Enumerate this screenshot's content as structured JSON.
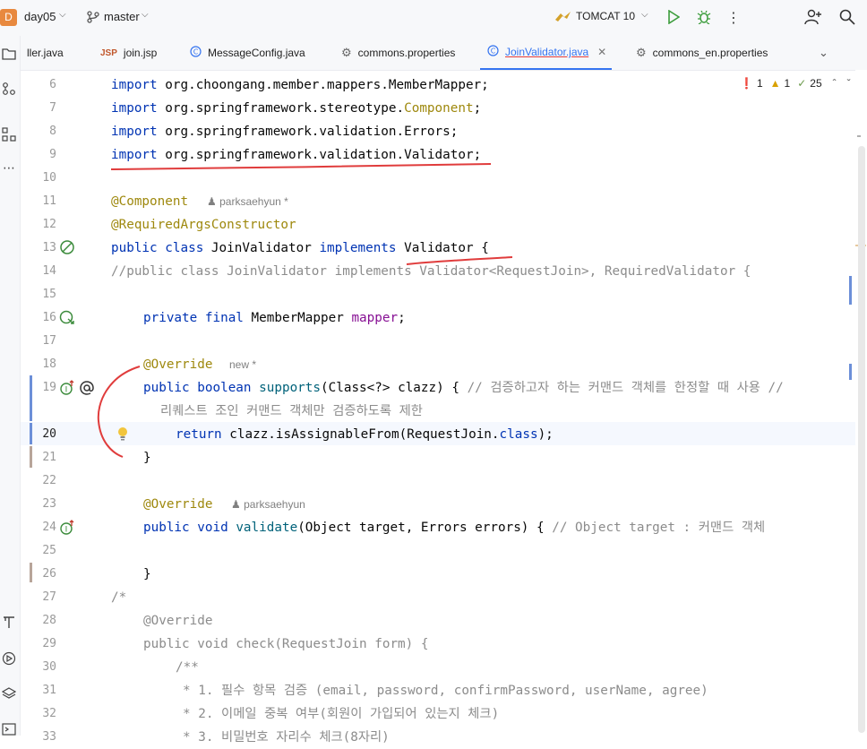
{
  "topbar": {
    "project_initial": "D",
    "project_name": "day05",
    "branch": "master",
    "run_config": "TOMCAT 10"
  },
  "tabs": [
    {
      "label": "ller.java",
      "type": "java"
    },
    {
      "label": "join.jsp",
      "type": "jsp",
      "badge": "JSP"
    },
    {
      "label": "MessageConfig.java",
      "type": "class"
    },
    {
      "label": "commons.properties",
      "type": "properties"
    },
    {
      "label": "JoinValidator.java",
      "type": "class",
      "active": true
    },
    {
      "label": "commons_en.properties",
      "type": "properties"
    }
  ],
  "issues": {
    "errors": "1",
    "warnings": "1",
    "weak_warnings": "25"
  },
  "editor": {
    "line_numbers": [
      "6",
      "7",
      "8",
      "9",
      "10",
      "11",
      "12",
      "13",
      "14",
      "15",
      "16",
      "17",
      "18",
      "19",
      "",
      "20",
      "21",
      "22",
      "23",
      "24",
      "25",
      "26",
      "27",
      "28",
      "29",
      "30",
      "31",
      "32",
      "33"
    ],
    "inlay": {
      "author1": "parksaehyun *",
      "author_new": "new *",
      "author2": "parksaehyun"
    },
    "lines": {
      "l6": "org.choongang.member.mappers.MemberMapper;",
      "l7a": "org.springframework.stereotype.",
      "l7b": "Component",
      "l8": "org.springframework.validation.Errors;",
      "l9": "org.springframework.validation.Validator;",
      "l11": "@Component",
      "l12": "@RequiredArgsConstructor",
      "l13_name": "JoinValidator",
      "l13_iface": "Validator",
      "l14": "//public class JoinValidator implements Validator<RequestJoin>, RequiredValidator {",
      "l16_type": "MemberMapper",
      "l16_field": "mapper",
      "l18": "@Override",
      "l19_fn": "supports",
      "l19_args": "(Class<?> clazz) { ",
      "l19_cm": "// 검증하고자 하는 커맨드 객체를 한정할 때 사용 //",
      "l19b_cm": "리퀘스트 조인 커맨드 객체만 검증하도록 제한",
      "l20_body": "clazz.isAssignableFrom(RequestJoin.",
      "l20_end": ");",
      "l21": "}",
      "l23": "@Override",
      "l24_fn": "validate",
      "l24_args": "(Object target, Errors errors) { ",
      "l24_cm": "// Object target : 커맨드 객체",
      "l26": "}",
      "l27": "/*",
      "l28": "@Override",
      "l29": "public void check(RequestJoin form) {",
      "l30": "/**",
      "l31": "* 1. 필수 항목 검증 (email, password, confirmPassword, userName, agree)",
      "l32": "* 2. 이메일 중복 여부(회원이 가입되어 있는지 체크)",
      "l33": "* 3. 비밀번호 자리수 체크(8자리)"
    },
    "keywords": {
      "import": "import",
      "public": "public",
      "class": "class",
      "implements": "implements",
      "private": "private",
      "final": "final",
      "boolean": "boolean",
      "return": "return",
      "void": "void",
      "class_kw": "class",
      "brace": "{",
      "semi": ";"
    }
  },
  "colors": {
    "accent": "#3574f0",
    "annotation_ink": "#e03c3c",
    "keyword": "#0033b3",
    "annotation": "#9e880d"
  }
}
